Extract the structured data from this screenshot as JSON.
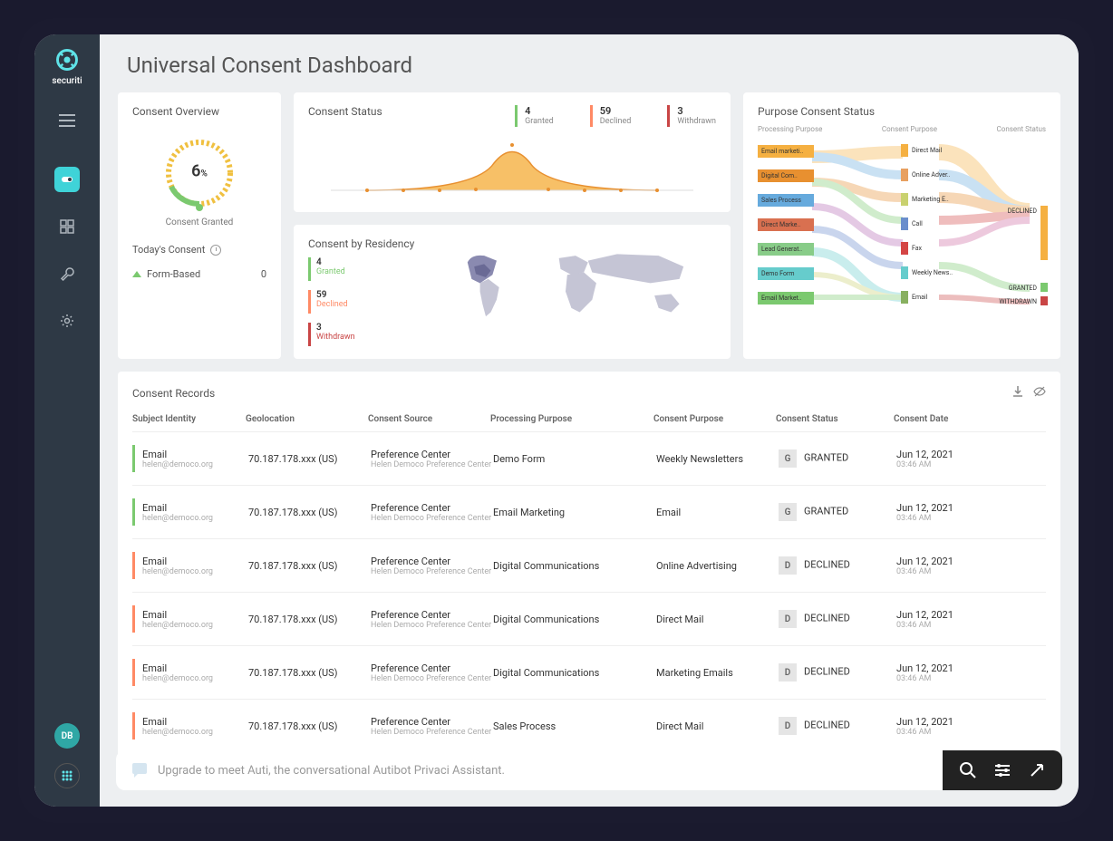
{
  "brand": "securiti",
  "page_title": "Universal Consent Dashboard",
  "overview": {
    "title": "Consent Overview",
    "gauge_value": "6",
    "gauge_pct": "%",
    "gauge_label": "Consent Granted",
    "today_title": "Today's Consent",
    "today_item": "Form-Based",
    "today_value": "0"
  },
  "status": {
    "title": "Consent Status",
    "items": [
      {
        "num": "4",
        "label": "Granted",
        "color": "#7bc96f"
      },
      {
        "num": "59",
        "label": "Declined",
        "color": "#ff8a65"
      },
      {
        "num": "3",
        "label": "Withdrawn",
        "color": "#c94545"
      }
    ]
  },
  "residency": {
    "title": "Consent by Residency",
    "items": [
      {
        "num": "4",
        "label": "Granted",
        "color": "#7bc96f"
      },
      {
        "num": "59",
        "label": "Declined",
        "color": "#ff8a65"
      },
      {
        "num": "3",
        "label": "Withdrawn",
        "color": "#c94545"
      }
    ]
  },
  "purpose": {
    "title": "Purpose Consent Status",
    "col1": "Processing Purpose",
    "col2": "Consent Purpose",
    "col3": "Consent Status",
    "left_nodes": [
      "Email marketi..",
      "Digital Com..",
      "Sales Process",
      "Direct Marke..",
      "Lead Generat..",
      "Demo Form",
      "Email Market.."
    ],
    "mid_nodes": [
      "Direct Mail",
      "Online Adver..",
      "Marketing E..",
      "Call",
      "Fax",
      "Weekly News..",
      "Email"
    ],
    "right_nodes": [
      "DECLINED",
      "GRANTED",
      "WITHDRAWN"
    ]
  },
  "records": {
    "title": "Consent Records",
    "columns": [
      "Subject Identity",
      "Geolocation",
      "Consent Source",
      "Processing Purpose",
      "Consent Purpose",
      "Consent Status",
      "Consent Date"
    ],
    "rows": [
      {
        "subj": "Email",
        "subj_sub": "helen@democo.org",
        "geo": "70.187.178.xxx (US)",
        "src": "Preference Center",
        "src_sub": "Helen Democo Preference Center",
        "proc": "Demo Form",
        "purp": "Weekly Newsletters",
        "badge": "G",
        "status": "GRANTED",
        "date": "Jun 12, 2021",
        "time": "03:46 AM",
        "bar": "granted"
      },
      {
        "subj": "Email",
        "subj_sub": "helen@democo.org",
        "geo": "70.187.178.xxx (US)",
        "src": "Preference Center",
        "src_sub": "Helen Democo Preference Center",
        "proc": "Email Marketing",
        "purp": "Email",
        "badge": "G",
        "status": "GRANTED",
        "date": "Jun 12, 2021",
        "time": "03:46 AM",
        "bar": "granted"
      },
      {
        "subj": "Email",
        "subj_sub": "helen@democo.org",
        "geo": "70.187.178.xxx (US)",
        "src": "Preference Center",
        "src_sub": "Helen Democo Preference Center",
        "proc": "Digital Communications",
        "purp": "Online Advertising",
        "badge": "D",
        "status": "DECLINED",
        "date": "Jun 12, 2021",
        "time": "03:46 AM",
        "bar": "declined"
      },
      {
        "subj": "Email",
        "subj_sub": "helen@democo.org",
        "geo": "70.187.178.xxx (US)",
        "src": "Preference Center",
        "src_sub": "Helen Democo Preference Center",
        "proc": "Digital Communications",
        "purp": "Direct Mail",
        "badge": "D",
        "status": "DECLINED",
        "date": "Jun 12, 2021",
        "time": "03:46 AM",
        "bar": "declined"
      },
      {
        "subj": "Email",
        "subj_sub": "helen@democo.org",
        "geo": "70.187.178.xxx (US)",
        "src": "Preference Center",
        "src_sub": "Helen Democo Preference Center",
        "proc": "Digital Communications",
        "purp": "Marketing Emails",
        "badge": "D",
        "status": "DECLINED",
        "date": "Jun 12, 2021",
        "time": "03:46 AM",
        "bar": "declined"
      },
      {
        "subj": "Email",
        "subj_sub": "helen@democo.org",
        "geo": "70.187.178.xxx (US)",
        "src": "Preference Center",
        "src_sub": "Helen Democo Preference Center",
        "proc": "Sales Process",
        "purp": "Direct Mail",
        "badge": "D",
        "status": "DECLINED",
        "date": "Jun 12, 2021",
        "time": "03:46 AM",
        "bar": "declined"
      }
    ]
  },
  "footer": {
    "placeholder": "Upgrade to meet Auti, the conversational Autibot Privaci Assistant."
  },
  "avatar": "DB",
  "chart_data": {
    "type": "area",
    "title": "Consent Status distribution",
    "points": [
      0,
      1,
      2,
      3,
      4,
      5,
      6,
      7,
      8,
      9,
      10
    ],
    "values": [
      0,
      0,
      0,
      1,
      3,
      6,
      3,
      1,
      0,
      0,
      0
    ]
  }
}
